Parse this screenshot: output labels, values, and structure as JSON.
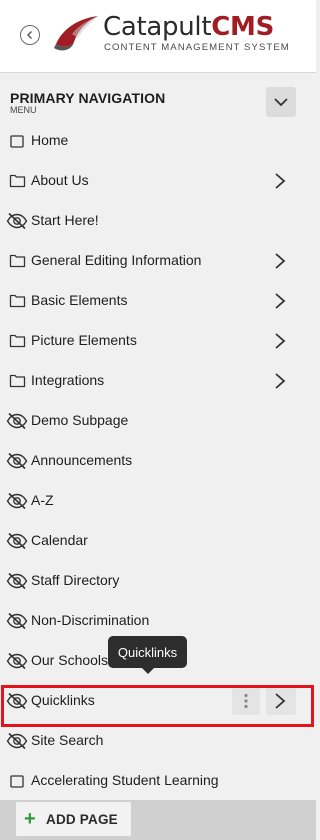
{
  "logo": {
    "word_plain": "Catapult",
    "word_brand": "CMS",
    "tagline": "CONTENT MANAGEMENT SYSTEM",
    "brand_color": "#a01d24"
  },
  "nav": {
    "title": "PRIMARY NAVIGATION",
    "subtitle": "MENU",
    "items": [
      {
        "label": "Home",
        "icon": "page-icon",
        "has_children": false
      },
      {
        "label": "About Us",
        "icon": "folder-icon",
        "has_children": true
      },
      {
        "label": "Start Here!",
        "icon": "eye-slash-icon",
        "has_children": false
      },
      {
        "label": "General Editing Information",
        "icon": "folder-icon",
        "has_children": true
      },
      {
        "label": "Basic Elements",
        "icon": "folder-icon",
        "has_children": true
      },
      {
        "label": "Picture Elements",
        "icon": "folder-icon",
        "has_children": true
      },
      {
        "label": "Integrations",
        "icon": "folder-icon",
        "has_children": true
      },
      {
        "label": "Demo Subpage",
        "icon": "eye-slash-icon",
        "has_children": false
      },
      {
        "label": "Announcements",
        "icon": "eye-slash-icon",
        "has_children": false
      },
      {
        "label": "A-Z",
        "icon": "eye-slash-icon",
        "has_children": false
      },
      {
        "label": "Calendar",
        "icon": "eye-slash-icon",
        "has_children": false
      },
      {
        "label": "Staff Directory",
        "icon": "eye-slash-icon",
        "has_children": false
      },
      {
        "label": "Non-Discrimination",
        "icon": "eye-slash-icon",
        "has_children": false
      },
      {
        "label": "Our Schools",
        "icon": "eye-slash-icon",
        "has_children": false
      },
      {
        "label": "Quicklinks",
        "icon": "eye-slash-icon",
        "has_children": false,
        "selected": true
      },
      {
        "label": "Site Search",
        "icon": "eye-slash-icon",
        "has_children": false
      },
      {
        "label": "Accelerating Student Learning",
        "icon": "page-icon",
        "has_children": false
      }
    ]
  },
  "tooltip": {
    "text": "Quicklinks"
  },
  "footer": {
    "add_label": "ADD PAGE"
  },
  "colors": {
    "highlight": "#e2151c",
    "add_plus": "#2e9b3b"
  }
}
